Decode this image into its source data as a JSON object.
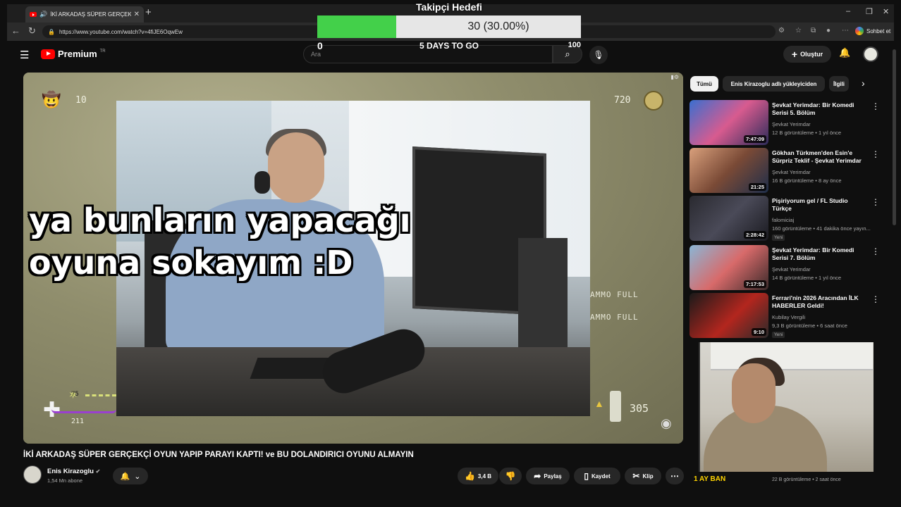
{
  "browser": {
    "tab_title": "İKİ ARKADAŞ SÜPER GERÇEKÇİ",
    "url": "https://www.youtube.com/watch?v=4fiJE6OqwEw",
    "sohbet_label": "Sohbet et"
  },
  "youtube": {
    "brand": "Premium",
    "region": "TR",
    "search_placeholder": "Ara",
    "create_label": "Oluştur"
  },
  "goal_overlay": {
    "title": "Takipçi Hedefi",
    "progress_text": "30 (30.00%)",
    "progress_fraction": 0.3,
    "min": "0",
    "max": "100",
    "days_left": "5 DAYS TO GO",
    "fill_color": "#43d04a"
  },
  "video": {
    "caption_line1": "ya bunların yapacağı",
    "caption_line2": "oyuna sokayım :D",
    "hud_top_left": "10",
    "hud_top_right": "720",
    "hud_health": "75",
    "hud_armor": "211",
    "hud_ammo": "305",
    "ammo_full_1": "AMMO FULL",
    "ammo_full_2": "AMMO FULL",
    "title": "İKİ ARKADAŞ SÜPER GERÇEKÇİ OYUN YAPIP PARAYI KAPTI! ve BU DOLANDIRICI OYUNU ALMAYIN",
    "channel": "Enis Kirazoglu",
    "subscribers": "1,54 Mn abone",
    "likes": "3,4 B",
    "share": "Paylaş",
    "save": "Kaydet",
    "clip": "Klip"
  },
  "sidebar": {
    "chips": [
      "Tümü",
      "Enis Kirazoglu adlı yükleyiciden",
      "İlgili"
    ],
    "recommendations": [
      {
        "title": "Şevkat Yerimdar: Bir Komedi Serisi 5. Bölüm",
        "channel": "Şevkat Yerimdar",
        "meta": "12 B görüntüleme • 1 yıl önce",
        "duration": "7:47:09",
        "new": ""
      },
      {
        "title": "Gökhan Türkmen'den Esin'e Sürpriz Teklif - Şevkat Yerimdar",
        "channel": "Şevkat Yerimdar",
        "meta": "16 B görüntüleme • 8 ay önce",
        "duration": "21:25",
        "new": ""
      },
      {
        "title": "Pişiriyorum gel / FL Studio Türkçe",
        "channel": "falomiciaj",
        "meta": "160 görüntüleme • 41 dakika önce yayın...",
        "duration": "2:28:42",
        "new": "Yeni"
      },
      {
        "title": "Şevkat Yerimdar: Bir Komedi Serisi 7. Bölüm",
        "channel": "Şevkat Yerimdar",
        "meta": "14 B görüntüleme • 1 yıl önce",
        "duration": "7:17:53",
        "new": ""
      },
      {
        "title": "Ferrari'nin 2026 Aracından İLK HABERLER Geldi!",
        "channel": "Kubilay Vergili",
        "meta": "9,3 B görüntüleme • 6 saat önce",
        "duration": "9:10",
        "new": "Yeni"
      }
    ],
    "bottom_meta": "22 B görüntüleme • 2 saat önce",
    "bottom_overlay": "1 AY BAN"
  }
}
